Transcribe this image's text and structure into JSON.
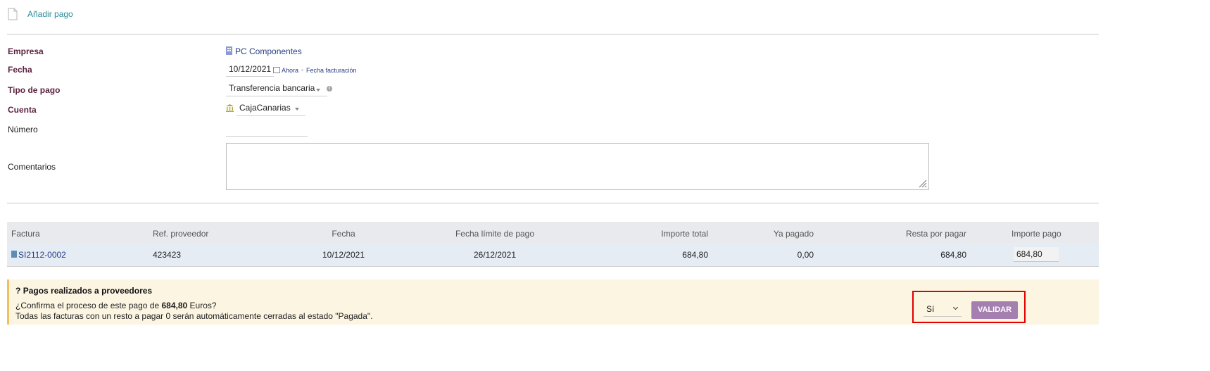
{
  "header": {
    "title": "Añadir pago"
  },
  "form": {
    "empresa": {
      "label": "Empresa",
      "value": "PC Componentes"
    },
    "fecha": {
      "label": "Fecha",
      "value": "10/12/2021",
      "link_now": "Ahora",
      "separator": "-",
      "link_invoice_date": "Fecha facturación"
    },
    "tipo_pago": {
      "label": "Tipo de pago",
      "value": "Transferencia bancaria"
    },
    "cuenta": {
      "label": "Cuenta",
      "value": "CajaCanarias"
    },
    "numero": {
      "label": "Número",
      "value": ""
    },
    "comentarios": {
      "label": "Comentarios",
      "value": ""
    }
  },
  "table": {
    "headers": [
      "Factura",
      "Ref. proveedor",
      "Fecha",
      "Fecha límite de pago",
      "Importe total",
      "Ya pagado",
      "Resta por pagar",
      "Importe pago"
    ],
    "rows": [
      {
        "factura": "SI2112-0002",
        "ref_proveedor": "423423",
        "fecha": "10/12/2021",
        "fecha_limite": "26/12/2021",
        "importe_total": "684,80",
        "ya_pagado": "0,00",
        "resta_por_pagar": "684,80",
        "importe_pago": "684,80"
      }
    ]
  },
  "confirm": {
    "icon": "?",
    "title": "Pagos realizados a proveedores",
    "line1_prefix": "¿Confirma el proceso de este pago de",
    "amount": "684,80",
    "line1_suffix": "Euros?",
    "line2": "Todas las facturas con un resto a pagar 0 serán automáticamente cerradas al estado \"Pagada\".",
    "select_value": "Sí",
    "button_label": "VALIDAR"
  },
  "colors": {
    "accent_button": "#a47fb0",
    "highlight_border": "#e00000",
    "label_color": "#5a2140",
    "link_color": "#263c82"
  }
}
